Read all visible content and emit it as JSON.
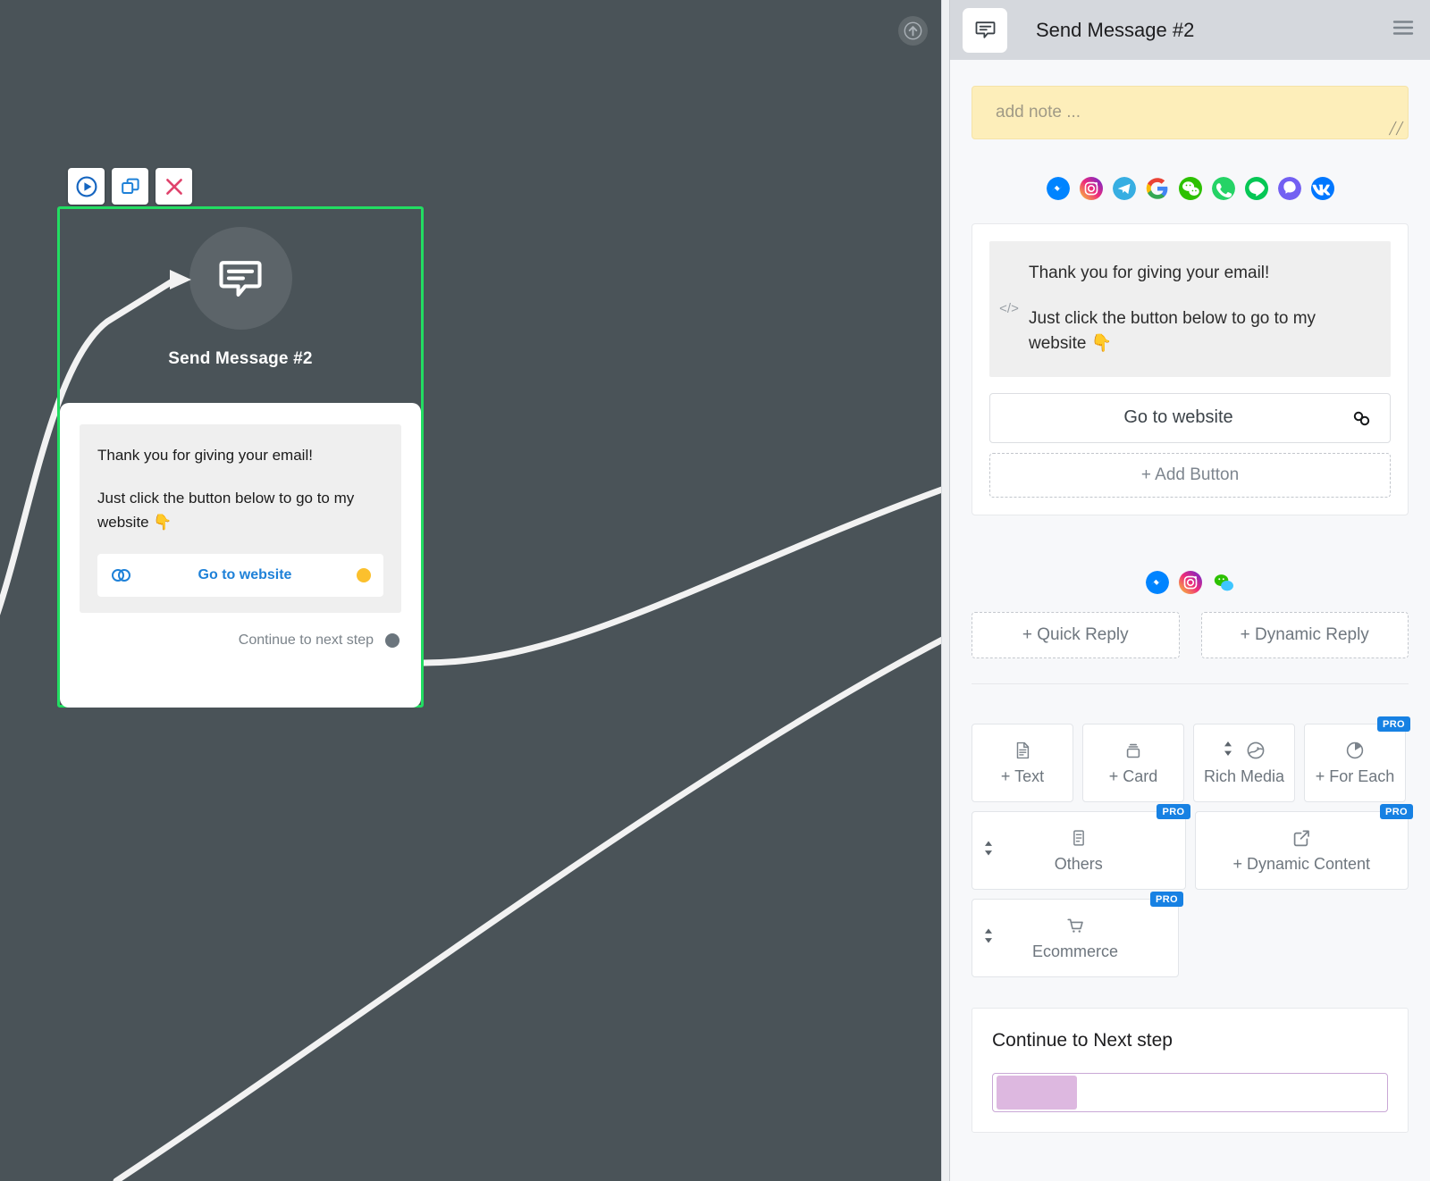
{
  "canvas": {
    "scroll_up_icon": "arrow-up-circle-icon",
    "node": {
      "title": "Send Message #2",
      "avatar_icon": "message-bubble-icon",
      "selected": true,
      "selection_color": "#22dd62",
      "toolbar": [
        {
          "name": "run-node-button",
          "icon": "play-circle-icon",
          "color": "#1565c0"
        },
        {
          "name": "duplicate-node-button",
          "icon": "duplicate-icon",
          "color": "#1e81d8"
        },
        {
          "name": "delete-node-button",
          "icon": "close-x-icon",
          "color": "#e0436c"
        }
      ],
      "bubble_lines": [
        "Thank you for giving your email!",
        "Just click the button below to go to my website 👇"
      ],
      "cta_label": "Go to website",
      "cta_icon": "chain-link-icon",
      "cta_dot_color": "#fbc02d",
      "continue_label": "Continue to next step",
      "continue_dot_color": "#6b757d"
    }
  },
  "panel": {
    "header": {
      "icon": "message-bubble-icon",
      "title": "Send Message #2",
      "menu_icon": "hamburger-menu-icon"
    },
    "note": {
      "placeholder": "add note ...",
      "resize_icon": "resize-grip-icon",
      "background": "#fdeeba"
    },
    "channels_main": [
      {
        "name": "messenger",
        "label": "Messenger"
      },
      {
        "name": "instagram",
        "label": "Instagram"
      },
      {
        "name": "telegram",
        "label": "Telegram"
      },
      {
        "name": "google",
        "label": "Google"
      },
      {
        "name": "wechat",
        "label": "WeChat"
      },
      {
        "name": "whatsapp",
        "label": "WhatsApp"
      },
      {
        "name": "line",
        "label": "LINE"
      },
      {
        "name": "viber",
        "label": "Viber"
      },
      {
        "name": "vk",
        "label": "VK"
      }
    ],
    "message": {
      "code_icon": "code-brackets-icon",
      "lines": [
        "Thank you for giving your email!",
        "Just click the button below to go to my website 👇"
      ],
      "button_label": "Go to website",
      "button_icon": "chain-link-icon",
      "add_button_label": "+ Add Button"
    },
    "channels_reply": [
      {
        "name": "messenger",
        "label": "Messenger"
      },
      {
        "name": "instagram",
        "label": "Instagram"
      },
      {
        "name": "wechat",
        "label": "WeChat"
      }
    ],
    "reply_buttons": [
      {
        "name": "add-quick-reply-button",
        "label": "+ Quick Reply"
      },
      {
        "name": "add-dynamic-reply-button",
        "label": "+ Dynamic Reply"
      }
    ],
    "blocks": {
      "row1": [
        {
          "name": "add-text-block",
          "label": "+ Text",
          "icon": "document-text-icon",
          "pro": false,
          "sortable": false
        },
        {
          "name": "add-card-block",
          "label": "+ Card",
          "icon": "card-stack-icon",
          "pro": false,
          "sortable": false
        },
        {
          "name": "rich-media-block",
          "label": "Rich Media",
          "icon": "image-icon",
          "pro": false,
          "sortable": true
        },
        {
          "name": "add-for-each-block",
          "label": "+ For Each",
          "icon": "pie-chart-icon",
          "pro": true,
          "sortable": false
        }
      ],
      "row2": [
        {
          "name": "others-block",
          "label": "Others",
          "icon": "list-document-icon",
          "pro": true,
          "sortable": true
        },
        {
          "name": "add-dynamic-content-block",
          "label": "+ Dynamic Content",
          "icon": "external-link-icon",
          "pro": true,
          "sortable": false
        }
      ],
      "row3": [
        {
          "name": "ecommerce-block",
          "label": "Ecommerce",
          "icon": "shopping-cart-icon",
          "pro": true,
          "sortable": true
        }
      ],
      "pro_badge_label": "PRO",
      "pro_badge_color": "#1781e3"
    },
    "next_step": {
      "title": "Continue to Next step",
      "chip_color": "#ddb8e0",
      "input_border_color": "#c9a8d6"
    }
  }
}
